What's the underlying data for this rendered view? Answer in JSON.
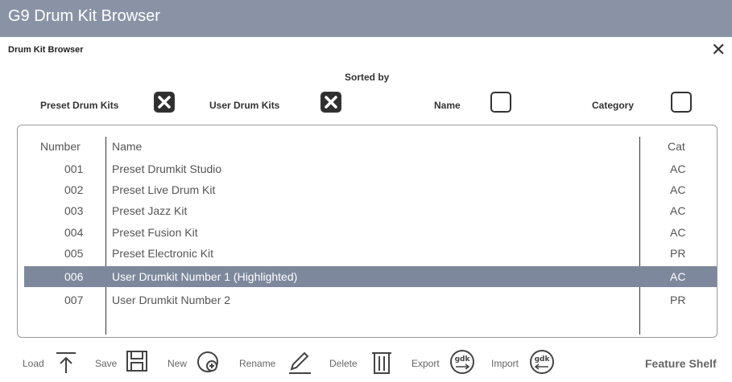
{
  "window": {
    "title": "G9 Drum Kit Browser"
  },
  "dialog": {
    "title": "Drum Kit Browser",
    "close_icon": "close-icon"
  },
  "filters": {
    "sorted_by_label": "Sorted by",
    "preset_label": "Preset Drum Kits",
    "preset_checked": true,
    "user_label": "User Drum Kits",
    "user_checked": true,
    "name_label": "Name",
    "name_checked": false,
    "category_label": "Category",
    "category_checked": false
  },
  "table": {
    "headers": {
      "number": "Number",
      "name": "Name",
      "cat": "Cat"
    },
    "rows": [
      {
        "number": "001",
        "name": "Preset Drumkit Studio",
        "cat": "AC"
      },
      {
        "number": "002",
        "name": "Preset Live Drum Kit",
        "cat": "AC"
      },
      {
        "number": "003",
        "name": "Preset Jazz Kit",
        "cat": "AC"
      },
      {
        "number": "004",
        "name": "Preset Fusion Kit",
        "cat": "AC"
      },
      {
        "number": "005",
        "name": "Preset Electronic Kit",
        "cat": "PR"
      },
      {
        "number": "006",
        "name": "User Drumkit Number 1 (Highlighted)",
        "cat": "AC"
      },
      {
        "number": "007",
        "name": "User Drumkit Number 2",
        "cat": "PR"
      }
    ],
    "selected_index": 5
  },
  "toolbar": {
    "load": "Load",
    "save": "Save",
    "new": "New",
    "rename": "Rename",
    "delete": "Delete",
    "export": "Export",
    "import": "Import",
    "gdk_icon_text": "gdk",
    "feature_shelf": "Feature Shelf"
  },
  "colors": {
    "title_bar": "#8a93a6",
    "selected_row": "#7d889c"
  }
}
